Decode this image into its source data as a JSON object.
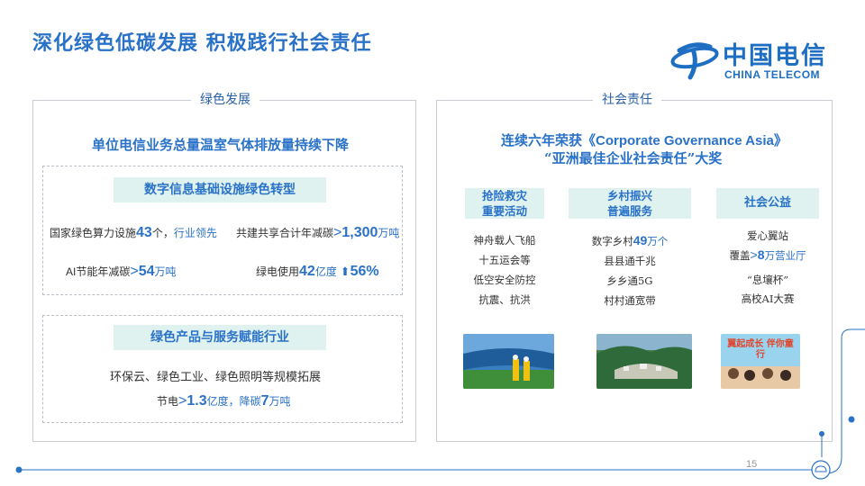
{
  "slide_title": "深化绿色低碳发展 积极践行社会责任",
  "logo": {
    "cn": "中国电信",
    "en": "CHINA TELECOM"
  },
  "green": {
    "label": "绿色发展",
    "headline": "单位电信业务总量温室气体排放量持续下降",
    "infra": {
      "chip": "数字信息基础设施绿色转型",
      "s1_prefix": "国家绿色算力设施",
      "s1_num": "43",
      "s1_unit": "个，",
      "s1_tail": "行业领先",
      "s2_prefix": "共建共享合计年减碳",
      "s2_gt": ">",
      "s2_num": "1,300",
      "s2_unit": "万吨",
      "s3_ai": "AI",
      "s3_prefix": "节能年减碳",
      "s3_gt": ">",
      "s3_num": "54",
      "s3_unit": "万吨",
      "s4_prefix": "绿电使用",
      "s4_num": "42",
      "s4_unit": "亿度",
      "s4_arrow": "⬆",
      "s4_pct": "56%"
    },
    "products": {
      "chip": "绿色产品与服务赋能行业",
      "line1": "环保云、绿色工业、绿色照明等规模拓展",
      "l2_a": "节电",
      "l2_gt": ">",
      "l2_num": "1.3",
      "l2_unit": "亿度，降碳",
      "l2_num2": "7",
      "l2_unit2": "万吨"
    }
  },
  "social": {
    "label": "社会责任",
    "headline1": "连续六年荣获《Corporate Governance Asia》",
    "headline2": "“亚洲最佳企业社会责任”大奖",
    "cols": [
      {
        "chip1": "抢险救灾",
        "chip2": "重要活动",
        "items": [
          "神舟载人飞船",
          "十五运会等",
          "低空安全防控",
          "抗震、抗洪"
        ]
      },
      {
        "chip1": "乡村振兴",
        "chip2": "普遍服务",
        "i1_prefix": "数字乡村",
        "i1_num": "49",
        "i1_unit": "万个",
        "items": [
          "县县通千兆",
          "乡乡通5G",
          "村村通宽带"
        ]
      },
      {
        "chip1": "社会公益",
        "i1": "爱心翼站",
        "i2_prefix": "覆盖",
        "i2_gt": ">",
        "i2_num": "8",
        "i2_unit": "万营业厅",
        "i3": "“息壤杯”",
        "i4_ai": "高校AI大赛"
      }
    ],
    "photo3_text": "翼起成长 伴你童行"
  },
  "page_number": "15",
  "colors": {
    "brand_blue": "#2a72c8",
    "chip_bg": "#dff2ef",
    "logo_blue": "#1e6fc4"
  }
}
